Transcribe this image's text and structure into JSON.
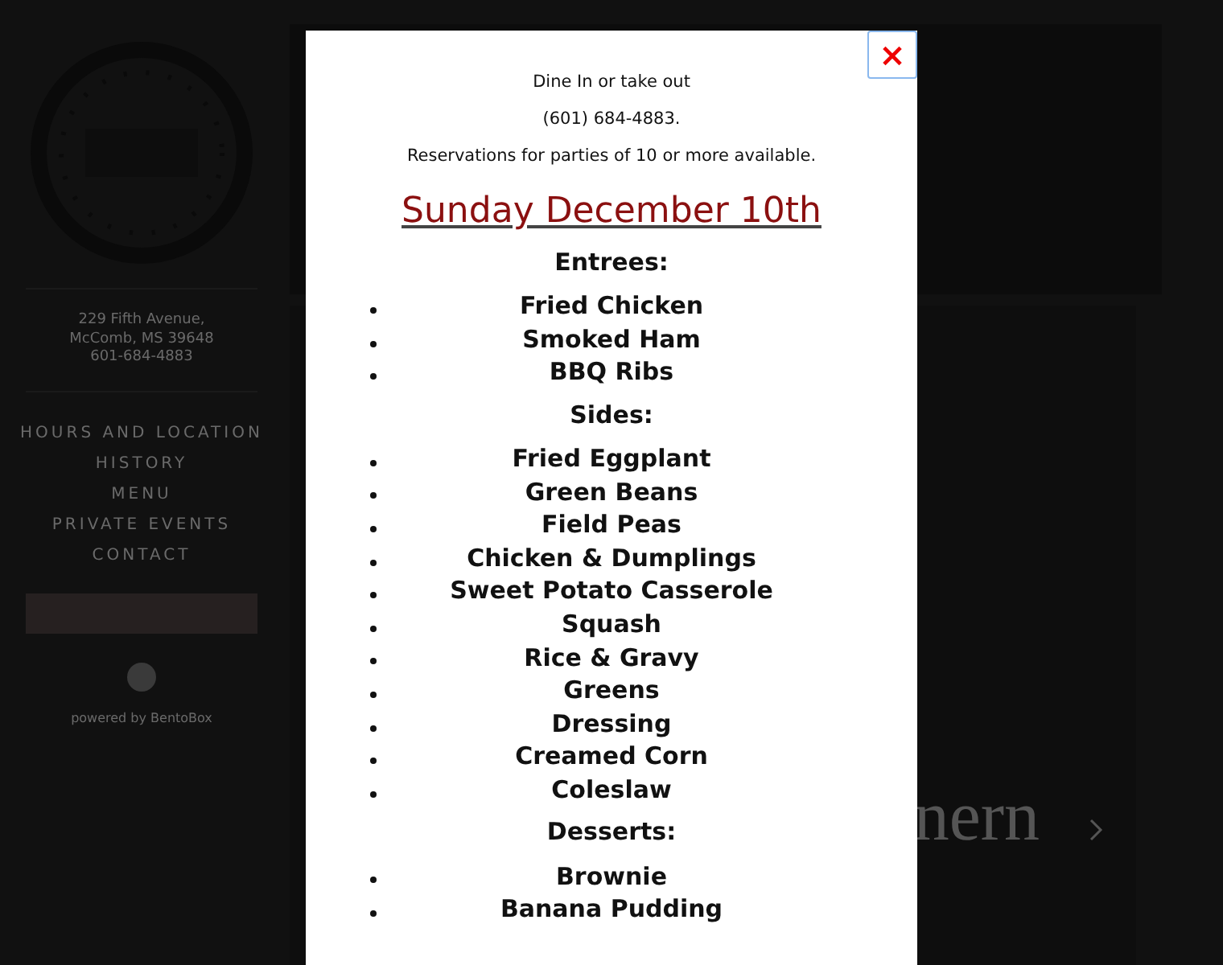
{
  "background": {
    "address": [
      "229 Fifth Avenue,",
      "McComb, MS 39648",
      "601-684-4883"
    ],
    "nav": [
      "HOURS AND LOCATION",
      "HISTORY",
      "MENU",
      "PRIVATE EVENTS",
      "CONTACT"
    ],
    "footer": "powered by BentoBox",
    "hero_text": "nern"
  },
  "modal": {
    "intro": [
      "Dine In or take out",
      "(601) 684-4883.",
      "Reservations for parties of 10 or more available."
    ],
    "close": "×",
    "title": "Sunday December 10th",
    "sections": [
      {
        "heading": "Entrees:",
        "items": [
          "Fried Chicken",
          "Smoked Ham",
          "BBQ Ribs"
        ]
      },
      {
        "heading": "Sides:",
        "items": [
          "Fried Eggplant",
          "Green Beans",
          "Field Peas",
          "Chicken & Dumplings",
          "Sweet Potato Casserole",
          "Squash",
          "Rice & Gravy",
          "Greens",
          "Dressing",
          "Creamed Corn",
          "Coleslaw"
        ]
      },
      {
        "heading": "Desserts:",
        "items": [
          "Brownie",
          "Banana Pudding"
        ]
      }
    ]
  }
}
